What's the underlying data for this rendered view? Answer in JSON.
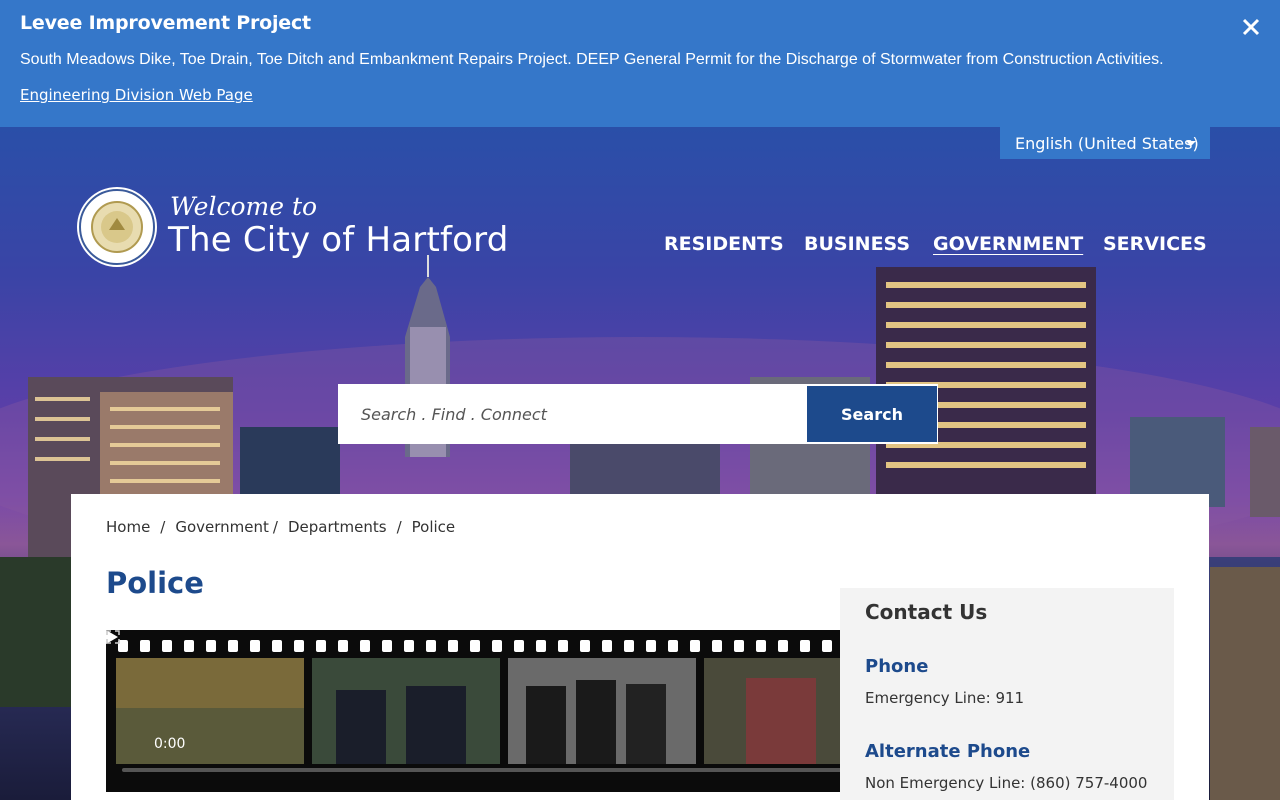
{
  "alert": {
    "title": "Levee Improvement Project",
    "text": "South Meadows Dike, Toe Drain, Toe Ditch and Embankment Repairs Project. DEEP General Permit for the Discharge of Stormwater from Construction Activities.",
    "link": "Engineering Division Web Page"
  },
  "language": {
    "selected": "English (United States)"
  },
  "header": {
    "welcome": "Welcome to",
    "city": "The City of Hartford",
    "nav": [
      "RESIDENTS",
      "BUSINESS",
      "GOVERNMENT",
      "SERVICES"
    ],
    "active_nav": "GOVERNMENT"
  },
  "search": {
    "placeholder": "Search . Find . Connect",
    "button": "Search"
  },
  "breadcrumb": [
    "Home",
    "Government",
    "Departments",
    "Police"
  ],
  "page": {
    "title": "Police"
  },
  "video": {
    "time": "0:00",
    "progress": 0
  },
  "contact": {
    "title": "Contact Us",
    "phone_label": "Phone",
    "phone_value": "Emergency Line: 911",
    "alt_phone_label": "Alternate Phone",
    "alt_phone_value": "Non Emergency Line: (860) 757-4000"
  },
  "colors": {
    "banner": "#3577c9",
    "accent": "#1d4a8c"
  }
}
